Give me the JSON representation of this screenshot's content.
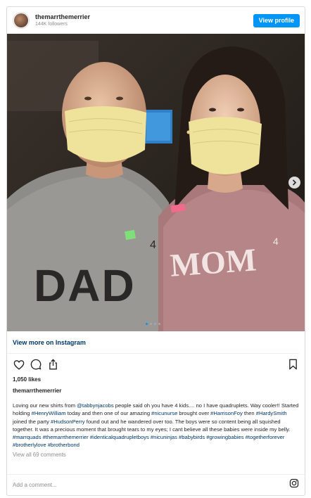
{
  "header": {
    "username": "themarrthemerrier",
    "followers": "144K followers",
    "view_profile": "View profile"
  },
  "photo": {
    "shirt_left": "DAD",
    "shirt_left_sup": "4",
    "shirt_right": "MOM",
    "shirt_right_sup": "4",
    "carousel_total": 4,
    "carousel_active": 1
  },
  "view_more": "View more on Instagram",
  "likes": "1,050 likes",
  "caption": {
    "username": "themarrthemerrier",
    "segments": [
      {
        "t": "Loving our new shirts from ",
        "h": false
      },
      {
        "t": "@tabbynjacobs",
        "h": true
      },
      {
        "t": " people said oh you have 4 kids.... no I have quadruplets. Way cooler!! Started holding ",
        "h": false
      },
      {
        "t": "#HenryWilliam",
        "h": true
      },
      {
        "t": " today and then one of our amazing ",
        "h": false
      },
      {
        "t": "#nicunurse",
        "h": true
      },
      {
        "t": " brought over ",
        "h": false
      },
      {
        "t": "#HarrisonFoy",
        "h": true
      },
      {
        "t": " then ",
        "h": false
      },
      {
        "t": "#HardySmith",
        "h": true
      },
      {
        "t": " joined the party ",
        "h": false
      },
      {
        "t": "#HudsonPerry",
        "h": true
      },
      {
        "t": " found out and he wandered over too. The boys were so content being all squished together. It was a precious moment that brought tears to my eyes; I cant believe all these babies were inside my belly. ",
        "h": false
      },
      {
        "t": "#marrquads",
        "h": true
      },
      {
        "t": " ",
        "h": false
      },
      {
        "t": "#themarrthemerrier",
        "h": true
      },
      {
        "t": " ",
        "h": false
      },
      {
        "t": "#identicalquadrupletboys",
        "h": true
      },
      {
        "t": " ",
        "h": false
      },
      {
        "t": "#nicuninjas",
        "h": true
      },
      {
        "t": " ",
        "h": false
      },
      {
        "t": "#babybirds",
        "h": true
      },
      {
        "t": " ",
        "h": false
      },
      {
        "t": "#growingbabies",
        "h": true
      },
      {
        "t": " ",
        "h": false
      },
      {
        "t": "#togetherforever",
        "h": true
      },
      {
        "t": " ",
        "h": false
      },
      {
        "t": "#brotherlylove",
        "h": true
      },
      {
        "t": " ",
        "h": false
      },
      {
        "t": "#brotherbond",
        "h": true
      }
    ]
  },
  "comments_link": "View all 69 comments",
  "add_comment_placeholder": "Add a comment...",
  "icons": [
    "heart-icon",
    "comment-icon",
    "share-icon",
    "bookmark-icon",
    "chevron-right-icon",
    "instagram-icon"
  ],
  "colors": {
    "accent": "#0095f6",
    "link": "#00376b",
    "muted": "#8e8e8e"
  }
}
